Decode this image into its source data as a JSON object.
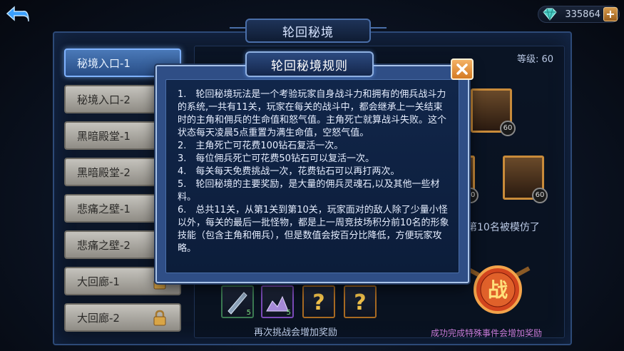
{
  "header": {
    "title": "轮回秘境",
    "currency_amount": "335864"
  },
  "tabs": [
    {
      "label": "秘境入口-1",
      "active": true,
      "locked": false
    },
    {
      "label": "秘境入口-2",
      "active": false,
      "locked": false
    },
    {
      "label": "黑暗殿堂-1",
      "active": false,
      "locked": false
    },
    {
      "label": "黑暗殿堂-2",
      "active": false,
      "locked": false
    },
    {
      "label": "悲痛之壁-1",
      "active": false,
      "locked": false
    },
    {
      "label": "悲痛之壁-2",
      "active": false,
      "locked": false
    },
    {
      "label": "大回廊-1",
      "active": false,
      "locked": true
    },
    {
      "label": "大回廊-2",
      "active": false,
      "locked": true
    }
  ],
  "panel": {
    "level_label": "等级: 60",
    "hero_level": "60",
    "info_fragment": "第10名被模仿了",
    "reward_counts": [
      "5",
      "5"
    ],
    "reward_caption": "再次挑战会增加奖励",
    "battle_label": "战",
    "battle_caption": "成功完成特殊事件会增加奖励"
  },
  "dialog": {
    "title": "轮回秘境规则",
    "rules": [
      "1.　轮回秘境玩法是一个考验玩家自身战斗力和拥有的佣兵战斗力的系统,一共有11关，玩家在每关的战斗中，都会继承上一关结束时的主角和佣兵的生命值和怒气值。主角死亡就算战斗失败。这个状态每天凌晨5点重置为满生命值，空怒气值。",
      "2.　主角死亡可花费100钻石复活一次。",
      "3.　每位佣兵死亡可花费50钻石可以复活一次。",
      "4.　每关每天免费挑战一次，花费钻石可以再打两次。",
      "5.　轮回秘境的主要奖励，是大量的佣兵灵魂石,以及其他一些材料。",
      "6.　总共11关，从第1关到第10关，玩家面对的敌人除了少量小怪以外，每关的最后一批怪物，都是上一周竞技场积分前10名的形象技能（包含主角和佣兵），但是数值会按百分比降低，方便玩家攻略。"
    ]
  },
  "colors": {
    "accent": "#4a79b8",
    "dialog_bg": "#2f4e86",
    "gold": "#c98b3a"
  }
}
